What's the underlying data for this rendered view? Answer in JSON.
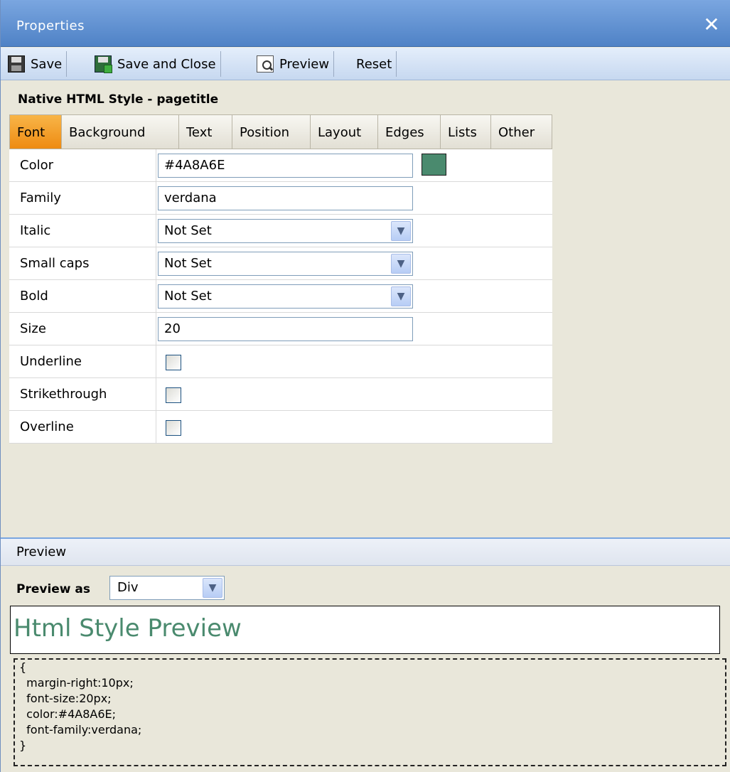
{
  "window": {
    "title": "Properties"
  },
  "toolbar": {
    "save_label": "Save",
    "save_close_label": "Save and Close",
    "preview_label": "Preview",
    "reset_label": "Reset"
  },
  "heading": "Native HTML Style - pagetitle",
  "tabs": [
    "Font",
    "Background",
    "Text",
    "Position",
    "Layout",
    "Edges",
    "Lists",
    "Other"
  ],
  "active_tab": "Font",
  "font_form": {
    "color": {
      "label": "Color",
      "value": "#4A8A6E",
      "swatch": "#4A8A6E"
    },
    "family": {
      "label": "Family",
      "value": "verdana"
    },
    "italic": {
      "label": "Italic",
      "value": "Not Set"
    },
    "small_caps": {
      "label": "Small caps",
      "value": "Not Set"
    },
    "bold": {
      "label": "Bold",
      "value": "Not Set"
    },
    "size": {
      "label": "Size",
      "value": "20"
    },
    "underline": {
      "label": "Underline",
      "checked": false
    },
    "strikethrough": {
      "label": "Strikethrough",
      "checked": false
    },
    "overline": {
      "label": "Overline",
      "checked": false
    }
  },
  "preview": {
    "section_title": "Preview",
    "preview_as_label": "Preview as",
    "preview_as_value": "Div",
    "sample_text": "Html Style Preview",
    "sample_color": "#4A8A6E",
    "css_lines": [
      "{",
      "  margin-right:10px;",
      "  font-size:20px;",
      "  color:#4A8A6E;",
      "  font-family:verdana;",
      "}"
    ]
  },
  "icons": {
    "close": "close-icon",
    "save": "floppy-disk-icon",
    "save_close": "floppy-disk-arrow-icon",
    "preview": "magnifier-icon",
    "dropdown": "chevron-down-icon"
  }
}
